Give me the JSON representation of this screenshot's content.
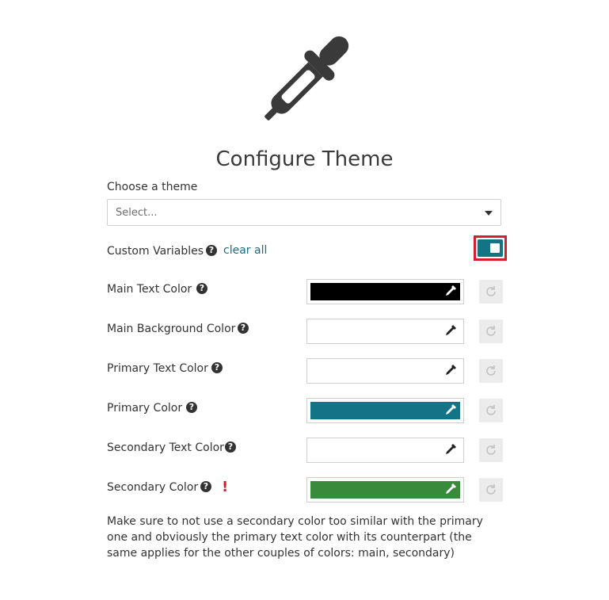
{
  "page": {
    "title": "Configure Theme",
    "hero_icon": "eyedropper-icon"
  },
  "theme": {
    "label": "Choose a theme",
    "placeholder": "Select..."
  },
  "custom_variables": {
    "label": "Custom Variables",
    "clear_label": "clear all",
    "toggle_on": true,
    "toggle_color": "#137487",
    "highlight_color": "#d3202f"
  },
  "colors": [
    {
      "label": "Main Text Color",
      "value": "#000000"
    },
    {
      "label": "Main Background Color",
      "value": "#ffffff"
    },
    {
      "label": "Primary Text Color",
      "value": "#ffffff"
    },
    {
      "label": "Primary Color",
      "value": "#137487"
    },
    {
      "label": "Secondary Text Color",
      "value": "#ffffff"
    },
    {
      "label": "Secondary Color",
      "value": "#3a8a3c",
      "warning": "!"
    }
  ],
  "help_icon": "question-circle-icon",
  "reset_icon": "refresh-icon",
  "note": "Make sure to not use a secondary color too similar with the primary one and obviously the primary text color with its counterpart (the same applies for the other couples of colors: main, secondary)"
}
